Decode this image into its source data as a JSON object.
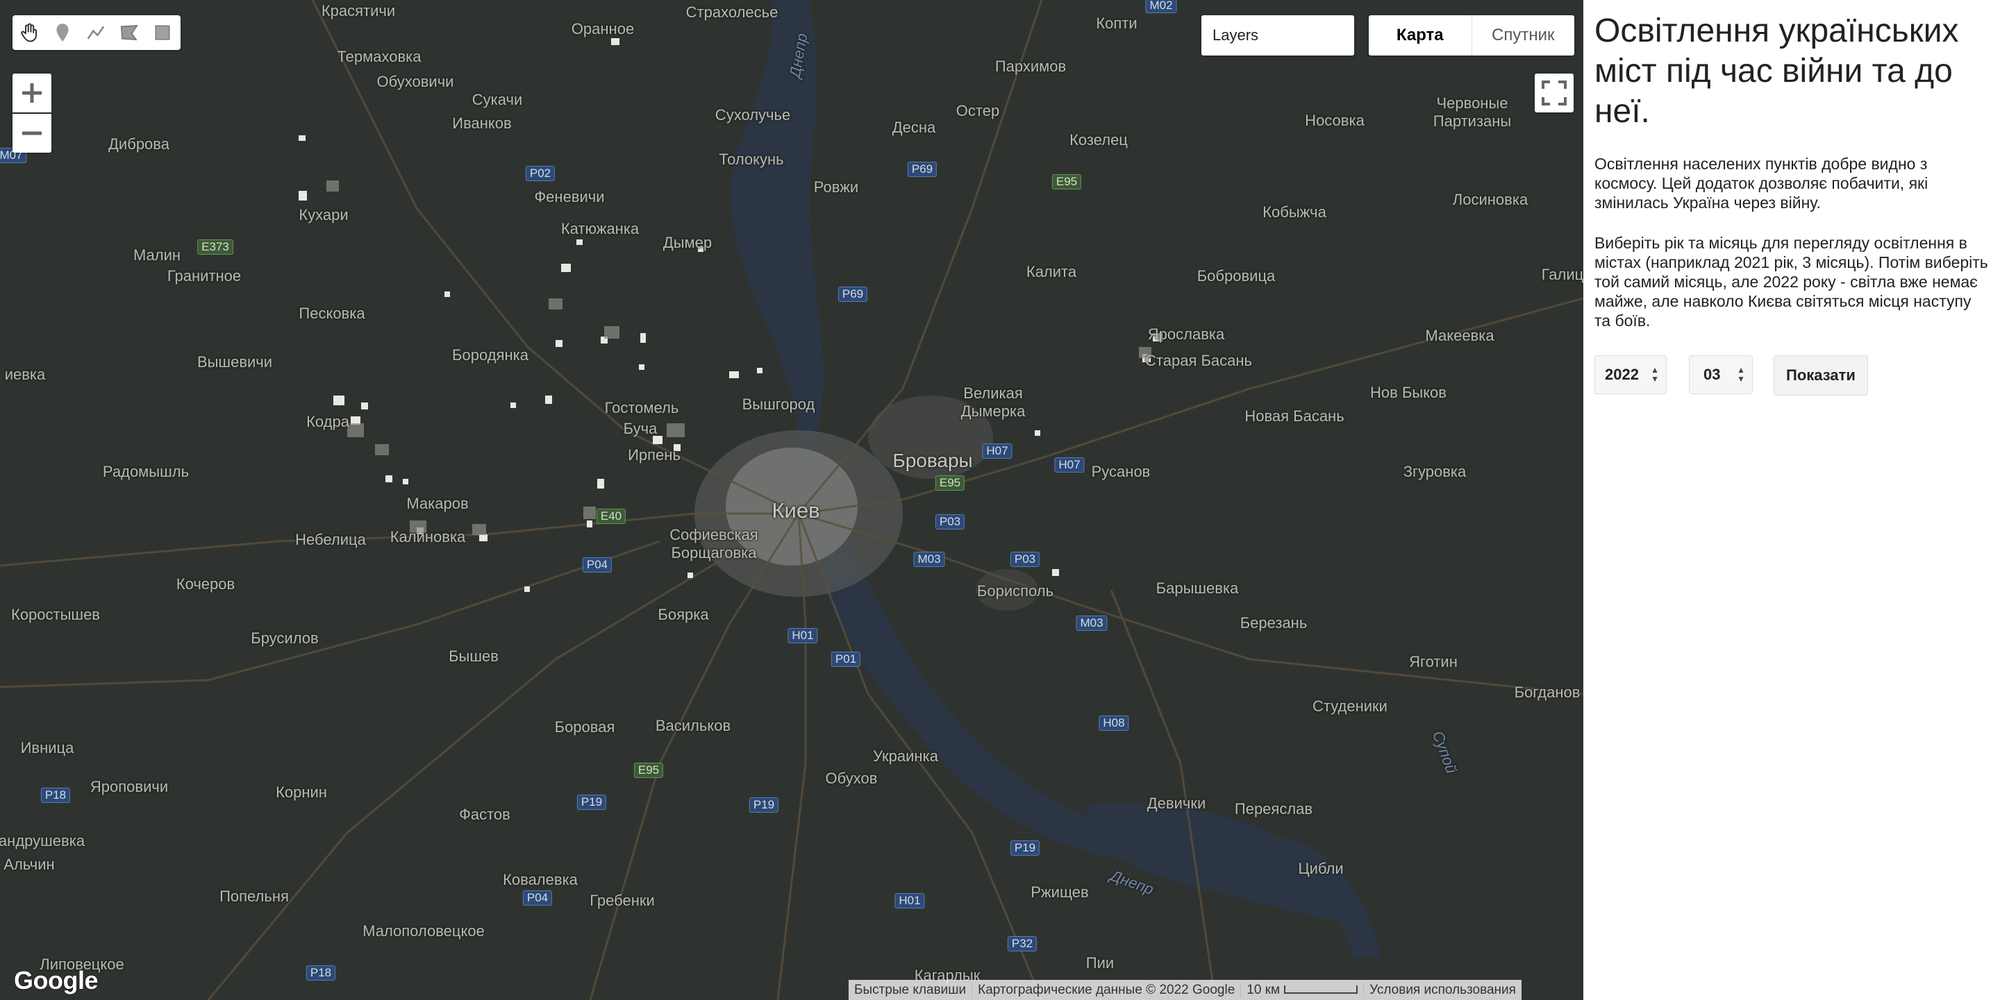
{
  "map": {
    "layers_label": "Layers",
    "map_type": {
      "map": "Карта",
      "satellite": "Спутник"
    },
    "google_logo": "Google",
    "attribution": {
      "shortcuts": "Быстрые клавиши",
      "map_data": "Картографические данные © 2022 Google",
      "scale": "10 км",
      "terms": "Условия использования"
    },
    "places": {
      "kyiv": "Киев",
      "brovary": "Бровары",
      "vyshhorod": "Вышгород",
      "irpin": "Ирпень",
      "bucha": "Буча",
      "hostomel": "Гостомель",
      "sofiivska": "Софиевская\nБорщаговка",
      "boyarka": "Боярка",
      "boryspil": "Борисполь",
      "velyka_dymerka": "Великая\nДымерка",
      "rusanov": "Русанов",
      "zgurovka": "Згуровка",
      "baryshevka": "Барышевка",
      "berezan": "Березань",
      "yagotin": "Яготин",
      "bogdanovka": "Богданов",
      "studeniki": "Студеники",
      "pereyaslav": "Переяслав",
      "tsybli": "Цибли",
      "devichki": "Девички",
      "rzhyshchev": "Ржищев",
      "ukrainka": "Украинка",
      "obukhov": "Обухов",
      "vasylkiv": "Васильков",
      "borova": "Боровая",
      "fastov": "Фастов",
      "kornin": "Корнин",
      "kovalevka": "Ковалевка",
      "grebenky": "Гребенки",
      "popelnya": "Попельня",
      "malopolovetskoe": "Малополовецкое",
      "andrushivka": "андрушевка",
      "kalynivka_w": "Калиновка",
      "makarov": "Макаров",
      "nebelitsa": "Небелица",
      "kocherov": "Кочеров",
      "korostyshev": "Коростышев",
      "brusilov": "Брусилов",
      "byshev": "Бышев",
      "ivnitsa": "Ивница",
      "yaropovichi": "Яроповичи",
      "radomyshl": "Радомышль",
      "kodra": "Кодра",
      "vyshevichi": "Вышевичи",
      "borodyanka": "Бородянка",
      "peskovka": "Песковка",
      "malin": "Малин",
      "granitnoe": "Гранитное",
      "kukhari": "Кухари",
      "dibrova": "Диброва",
      "ivankov": "Иванков",
      "sukachi": "Сукачи",
      "obukhovichi": "Обуховичи",
      "termakhovka": "Термаховка",
      "krasiatichi": "Красятичи",
      "oranoe": "Оранное",
      "strakholesye": "Страхолесье",
      "sukholuchye": "Сухолучье",
      "tolokun": "Толокунь",
      "rovzhi": "Ровжи",
      "dymer": "Дымер",
      "katyuzhanka": "Катюжанка",
      "fenevichi": "Феневичи",
      "kopti": "Копти",
      "parkhimov": "Пархимов",
      "ostor": "Остер",
      "desna": "Десна",
      "kozelets": "Козелец",
      "nosovka": "Носовка",
      "chervonye": "Червоные\nПартизаны",
      "losinovka": "Лосиновка",
      "kobyzhcha": "Кобыжча",
      "kalita": "Калита",
      "bobrovitsa": "Бобровица",
      "galitsa": "Галица",
      "yaroslavka": "Ярославка",
      "staraya_basan": "Старая Басань",
      "novaya_basan": "Новая Басань",
      "novoe_bykov": "Нов Быков",
      "makeevka": "Макеевка",
      "kagarlyk": "Кагарлык",
      "pii": "Пии",
      "lipovetskoe": "Липовецкое",
      "alchyn": "Альчин",
      "zhievka": "иевка",
      "river_dnepr": "Днепр",
      "river_supoy": "Супой"
    },
    "routes": [
      "P02",
      "P69",
      "E95",
      "E373",
      "P69",
      "H07",
      "H07",
      "E95",
      "P03",
      "P03",
      "M03",
      "M03",
      "E40",
      "P04",
      "H01",
      "P01",
      "H08",
      "E95",
      "P19",
      "P19",
      "P18",
      "P04",
      "P19",
      "H01",
      "P32",
      "P18",
      "M02",
      "M07"
    ]
  },
  "panel": {
    "title": "Освітлення українських міст під час війни та до неї.",
    "intro": "Освітлення населених пунктів добре видно з космосу. Цей додаток дозволяє побачити, які змінилась Україна через війну.",
    "instructions": "Виберіть рік та місяць для перегляду освітлення в містах (наприклад 2021 рік, 3 місяць). Потім виберіть той самий місяць, але 2022 року - світла вже немає майже, але навколо Києва світяться місця наступу та боїв.",
    "year_value": "2022",
    "month_value": "03",
    "show_button": "Показати"
  }
}
